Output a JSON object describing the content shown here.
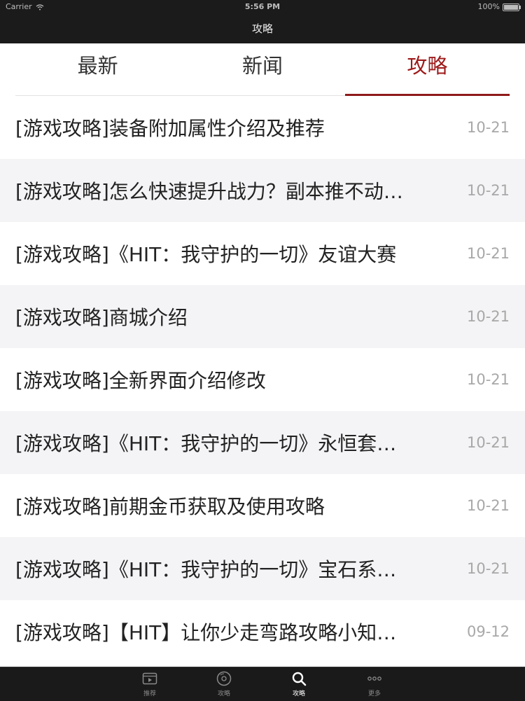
{
  "status_bar": {
    "carrier": "Carrier",
    "time": "5:56 PM",
    "battery": "100%"
  },
  "nav": {
    "title": "攻略"
  },
  "tabs": [
    {
      "label": "最新"
    },
    {
      "label": "新闻"
    },
    {
      "label": "攻略"
    }
  ],
  "articles": [
    {
      "title": "[游戏攻略]装备附加属性介绍及推荐",
      "date": "10-21"
    },
    {
      "title": "[游戏攻略]怎么快速提升战力？副本推不动…",
      "date": "10-21"
    },
    {
      "title": "[游戏攻略]《HIT：我守护的一切》友谊大赛",
      "date": "10-21"
    },
    {
      "title": "[游戏攻略]商城介绍",
      "date": "10-21"
    },
    {
      "title": "[游戏攻略]全新界面介绍修改",
      "date": "10-21"
    },
    {
      "title": "[游戏攻略]《HIT：我守护的一切》永恒套…",
      "date": "10-21"
    },
    {
      "title": "[游戏攻略]前期金币获取及使用攻略",
      "date": "10-21"
    },
    {
      "title": "[游戏攻略]《HIT：我守护的一切》宝石系…",
      "date": "10-21"
    },
    {
      "title": "[游戏攻略]【HIT】让你少走弯路攻略小知…",
      "date": "09-12"
    }
  ],
  "tabbar": [
    {
      "label": "推荐",
      "icon": "video-icon"
    },
    {
      "label": "攻略",
      "icon": "disc-icon"
    },
    {
      "label": "攻略",
      "icon": "search-icon"
    },
    {
      "label": "更多",
      "icon": "more-icon"
    }
  ],
  "colors": {
    "accent": "#9e1a1a",
    "bar": "#1b1b1b",
    "row_alt": "#f4f3f5"
  }
}
